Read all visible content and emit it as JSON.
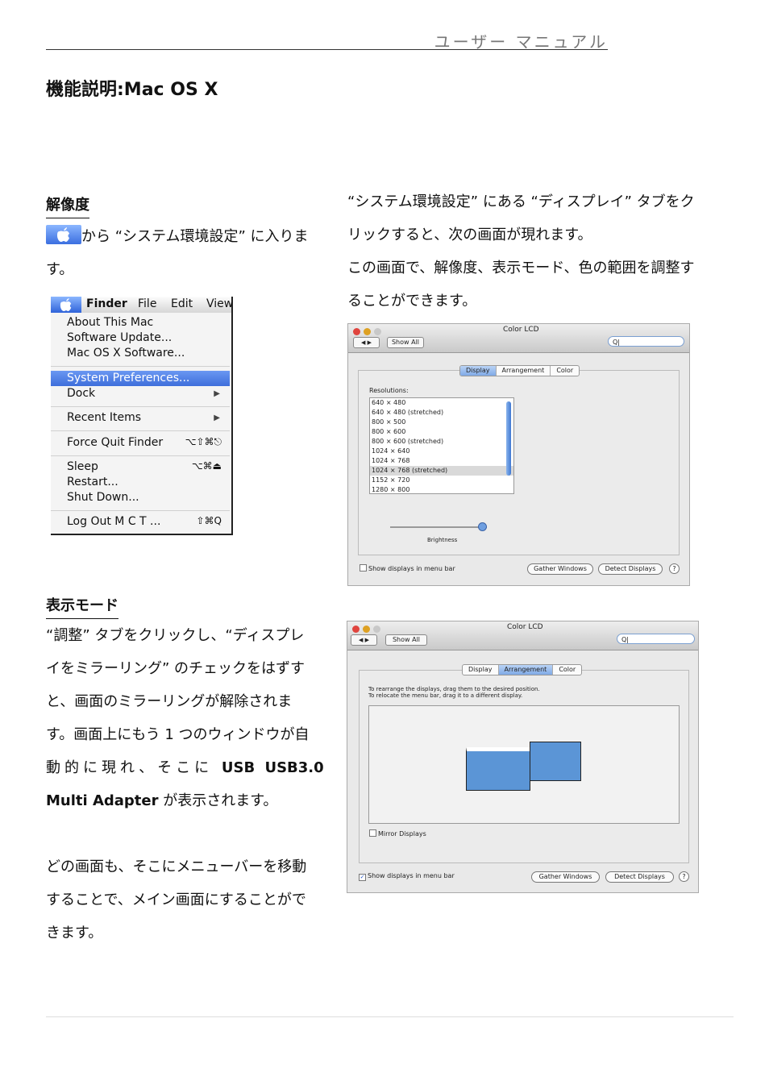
{
  "header": {
    "manual_title": "ユーザー マニュアル"
  },
  "page_title": "機能説明:Mac OS X",
  "resolution_section": {
    "heading": "解像度",
    "intro_part1": "から “システム環境設定” に入りま",
    "intro_part2": "す。",
    "right_lines": [
      "“システム環境設定” にある “ディスプレイ” タブをク",
      "リックすると、次の画面が現れます。",
      "この画面で、解像度、表示モード、色の範囲を調整す",
      "ることができます。"
    ]
  },
  "finder_menu": {
    "menubar": {
      "finder": "Finder",
      "file": "File",
      "edit": "Edit",
      "view": "View"
    },
    "items": {
      "about": "About This Mac",
      "software_update": "Software Update...",
      "software": "Mac OS X Software...",
      "system_preferences": "System Preferences...",
      "dock": "Dock",
      "recent": "Recent Items",
      "force_quit": "Force Quit Finder",
      "force_quit_shortcut": "⌥⇧⌘⎋",
      "sleep": "Sleep",
      "sleep_shortcut": "⌥⌘⏏",
      "restart": "Restart...",
      "shutdown": "Shut Down...",
      "logout": "Log Out M C T ...",
      "logout_shortcut": "⇧⌘Q"
    }
  },
  "display_window": {
    "title": "Color LCD",
    "show_all": "Show All",
    "search_placeholder": "Q|",
    "tabs": [
      "Display",
      "Arrangement",
      "Color"
    ],
    "resolutions_label": "Resolutions:",
    "resolutions": [
      "640 × 480",
      "640 × 480 (stretched)",
      "800 × 500",
      "800 × 600",
      "800 × 600 (stretched)",
      "1024 × 640",
      "1024 × 768",
      "1024 × 768 (stretched)",
      "1152 × 720",
      "1280 × 800"
    ],
    "selected_resolution": "1024 × 768 (stretched)",
    "brightness_label": "Brightness",
    "brightness_level": 0.95,
    "show_in_menu_bar": "Show displays in menu bar",
    "gather_windows": "Gather Windows",
    "detect_displays": "Detect Displays",
    "help": "?"
  },
  "display_mode_section": {
    "heading": "表示モード",
    "lines": [
      "“調整” タブをクリックし、“ディスプレ",
      "イをミラーリング” のチェックをはずす",
      "と、画面のミラーリングが解除されま",
      "す。画面上にもう 1 つのウィンドウが自"
    ],
    "line5_prefix": "動的に現れ、そこに ",
    "line5_bold": "USB USB3.0",
    "line6_bold": "Multi Adapter",
    "line6_suffix": " が表示されます。",
    "para2_lines": [
      "どの画面も、そこにメニューバーを移動",
      "することで、メイン画面にすることがで",
      "きます。"
    ]
  },
  "arrangement_window": {
    "title": "Color LCD",
    "show_all": "Show All",
    "search_placeholder": "Q|",
    "tabs": [
      "Display",
      "Arrangement",
      "Color"
    ],
    "instruction1": "To rearrange the displays, drag them to the desired position.",
    "instruction2": "To relocate the menu bar, drag it to a different display.",
    "mirror_displays": "Mirror Displays",
    "show_in_menu_bar": "Show displays in menu bar",
    "gather_windows": "Gather Windows",
    "detect_displays": "Detect Displays",
    "help": "?"
  },
  "colors": {
    "accent": "#3e6fdb",
    "display_blue": "#5b95d6"
  }
}
